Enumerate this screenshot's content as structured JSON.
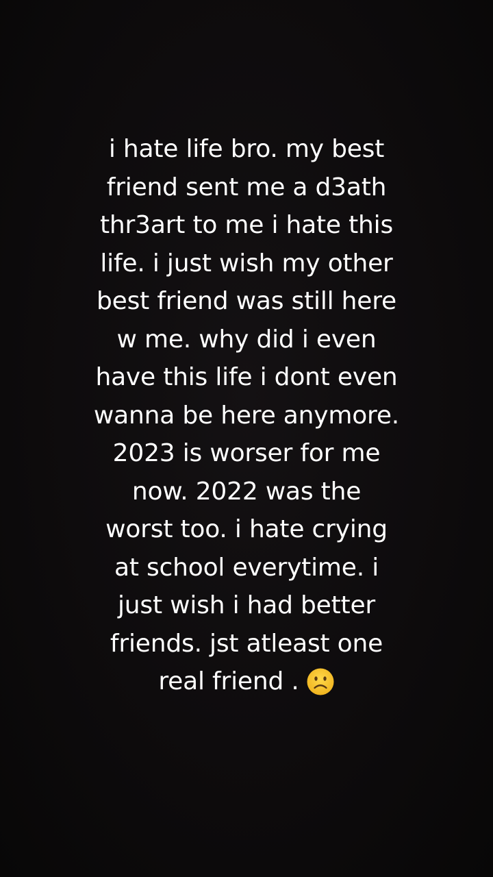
{
  "caption": {
    "lines": [
      "i hate life bro. my best",
      "friend sent me a d3ath",
      "thr3art to me i hate this",
      "life. i just wish my other",
      "best friend was still here",
      "w me. why did i even",
      "have this life i dont even",
      "wanna be here anymore.",
      "2023 is worser for me",
      "now. 2022 was the",
      "worst too. i hate crying",
      "at school everytime. i",
      "just wish i had better",
      "friends. jst atleast one"
    ],
    "last_line": "real friend .",
    "emoji_icon": "frowning-face-icon"
  },
  "colors": {
    "background": "#0d0b0c",
    "text": "#ffffff",
    "emoji_face": "#f6c431"
  }
}
